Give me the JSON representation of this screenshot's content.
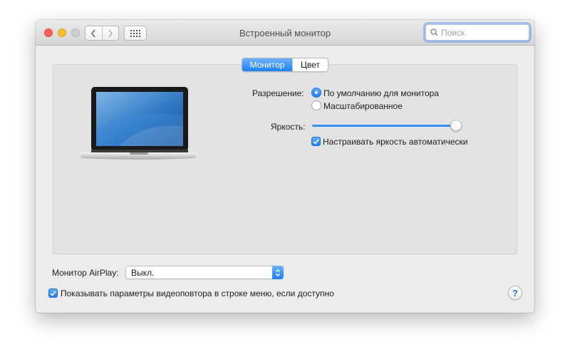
{
  "window": {
    "title": "Встроенный монитор"
  },
  "toolbar": {
    "back_icon": "chevron-left-icon",
    "forward_icon": "chevron-right-icon",
    "grid_icon": "grid-icon"
  },
  "search": {
    "placeholder": "Поиск",
    "value": ""
  },
  "tabs": [
    {
      "label": "Монитор",
      "selected": true
    },
    {
      "label": "Цвет",
      "selected": false
    }
  ],
  "display": {
    "resolution_label": "Разрешение:",
    "resolution_options": [
      {
        "label": "По умолчанию для монитора",
        "selected": true
      },
      {
        "label": "Масштабированное",
        "selected": false
      }
    ],
    "brightness_label": "Яркость:",
    "brightness_level": 0.96,
    "auto_brightness": {
      "label": "Настраивать яркость автоматически",
      "checked": true
    }
  },
  "airplay": {
    "label": "Монитор AirPlay:",
    "selected": "Выкл."
  },
  "mirroring": {
    "label": "Показывать параметры видеоповтора в строке меню, если доступно",
    "checked": true
  },
  "help": {
    "label": "?"
  },
  "colors": {
    "accent": "#1f7ff2",
    "close": "#fc5f57",
    "minimize": "#fdbc2e"
  }
}
